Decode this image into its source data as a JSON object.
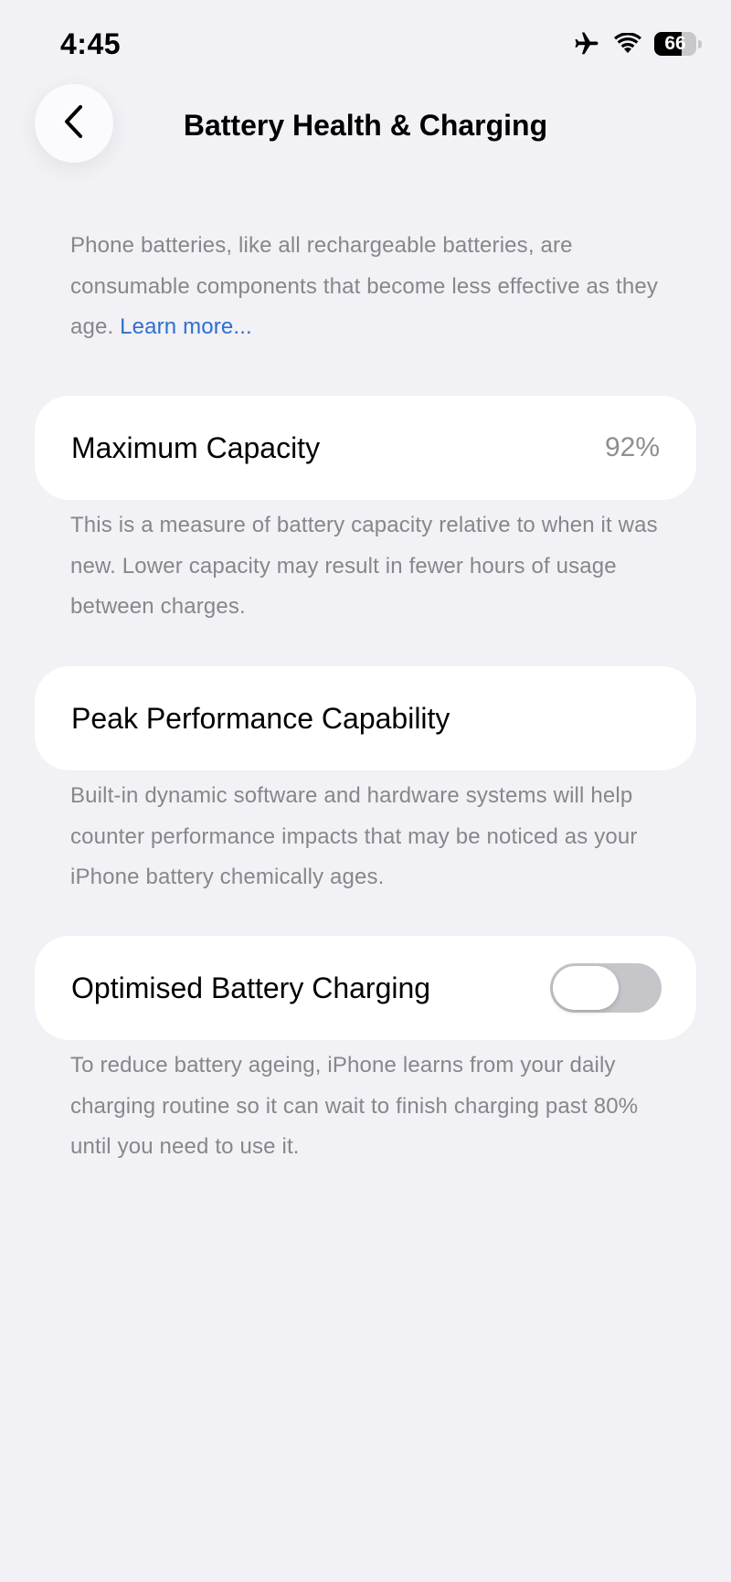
{
  "status_bar": {
    "time": "4:45",
    "battery_level": "66",
    "battery_fraction": 0.66
  },
  "nav": {
    "title": "Battery Health & Charging"
  },
  "intro": {
    "text": "Phone batteries, like all rechargeable batteries, are consumable components that become less effective as they age. ",
    "link": "Learn more..."
  },
  "max_capacity": {
    "label": "Maximum Capacity",
    "value": "92%",
    "description": "This is a measure of battery capacity relative to when it was new. Lower capacity may result in fewer hours of usage between charges."
  },
  "peak_performance": {
    "label": "Peak Performance Capability",
    "description": "Built-in dynamic software and hardware systems will help counter performance impacts that may be noticed as your iPhone battery chemically ages."
  },
  "optimised_charging": {
    "label": "Optimised Battery Charging",
    "enabled": false,
    "description": "To reduce battery ageing, iPhone learns from your daily charging routine so it can wait to finish charging past 80% until you need to use it."
  },
  "icons": {
    "airplane": "airplane-icon",
    "wifi": "wifi-icon",
    "battery": "battery-icon",
    "back": "chevron-left-icon"
  },
  "colors": {
    "background": "#f1f1f6",
    "card": "#ffffff",
    "secondary_text": "#86868b",
    "link": "#2f6fcd",
    "toggle_off": "#c6c6ca"
  }
}
